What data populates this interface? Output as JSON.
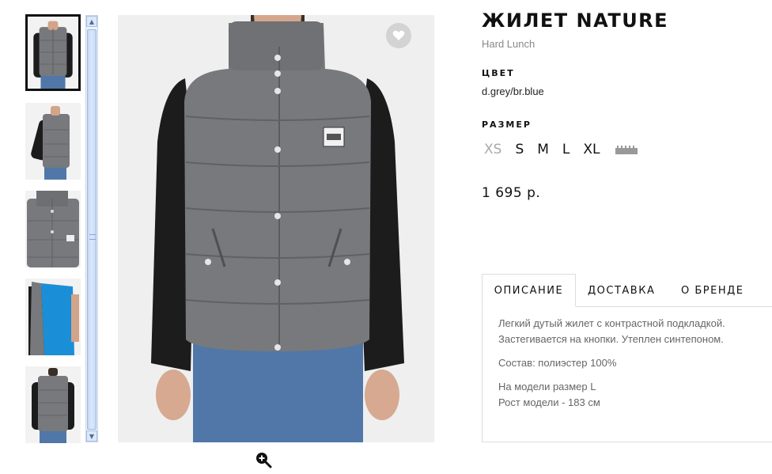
{
  "product": {
    "title": "ЖИЛЕТ NATURE",
    "brand": "Hard Lunch",
    "color_label": "ЦВЕТ",
    "color_value": "d.grey/br.blue",
    "size_label": "РАЗМЕР",
    "sizes": [
      {
        "label": "XS",
        "available": false
      },
      {
        "label": "S",
        "available": true
      },
      {
        "label": "M",
        "available": true
      },
      {
        "label": "L",
        "available": true
      },
      {
        "label": "XL",
        "available": true
      }
    ],
    "size_guide_icon": "ruler-icon",
    "price": "1 695 р."
  },
  "gallery": {
    "thumbnails": [
      "front",
      "side",
      "detail",
      "lining",
      "back"
    ],
    "selected_index": 0,
    "favorite_icon": "heart-icon",
    "zoom_icon": "zoom-in-icon"
  },
  "tabs": [
    {
      "label": "ОПИСАНИЕ",
      "active": true
    },
    {
      "label": "ДОСТАВКА",
      "active": false
    },
    {
      "label": "О БРЕНДЕ",
      "active": false
    }
  ],
  "description": {
    "line1": "Легкий дутый жилет с контрастной подкладкой.",
    "line2": "Застегивается на кнопки. Утеплен синтепоном.",
    "composition": "Состав: полиэстер 100%",
    "model_size": "На модели размер L",
    "model_height": "Рост модели - 183 см"
  },
  "colors": {
    "vest": "#77797c",
    "sleeve": "#1c1c1c",
    "jeans": "#5077a8",
    "lining": "#1a8fd8",
    "favorite_bg": "#d3d3d3",
    "scrollbar": "#c6d8f3"
  }
}
